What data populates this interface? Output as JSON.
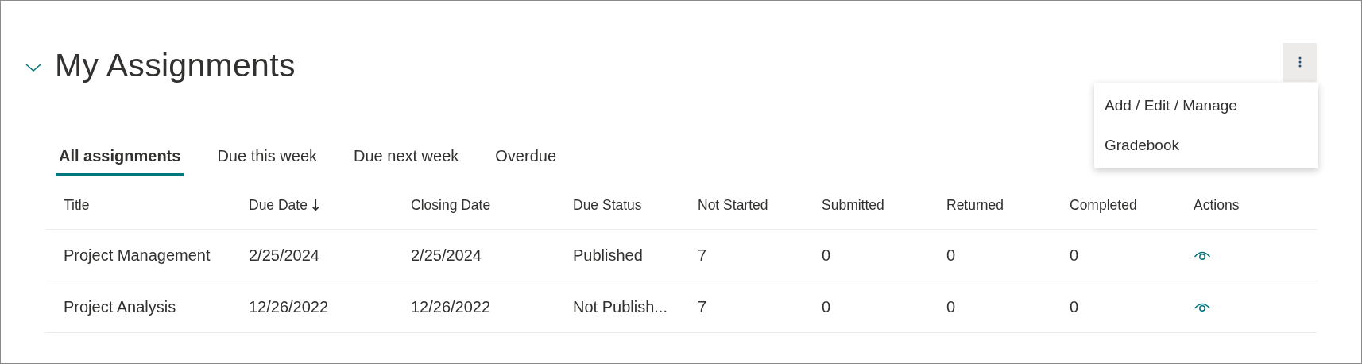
{
  "section": {
    "title": "My Assignments",
    "expanded": true
  },
  "more_menu": {
    "open": true,
    "items": [
      {
        "label": "Add / Edit / Manage"
      },
      {
        "label": "Gradebook"
      }
    ]
  },
  "tabs": [
    {
      "label": "All assignments",
      "selected": true
    },
    {
      "label": "Due this week",
      "selected": false
    },
    {
      "label": "Due next week",
      "selected": false
    },
    {
      "label": "Overdue",
      "selected": false
    }
  ],
  "table": {
    "columns": [
      {
        "label": "Title"
      },
      {
        "label": "Due Date",
        "sort_arrow": "↓"
      },
      {
        "label": "Closing Date"
      },
      {
        "label": "Due Status"
      },
      {
        "label": "Not Started"
      },
      {
        "label": "Submitted"
      },
      {
        "label": "Returned"
      },
      {
        "label": "Completed"
      },
      {
        "label": "Actions"
      }
    ],
    "rows": [
      {
        "cells": [
          "Project Management",
          "2/25/2024",
          "2/25/2024",
          "Published",
          "7",
          "0",
          "0",
          "0"
        ]
      },
      {
        "cells": [
          "Project Analysis",
          "12/26/2022",
          "12/26/2022",
          "Not Publish...",
          "7",
          "0",
          "0",
          "0"
        ]
      }
    ]
  }
}
